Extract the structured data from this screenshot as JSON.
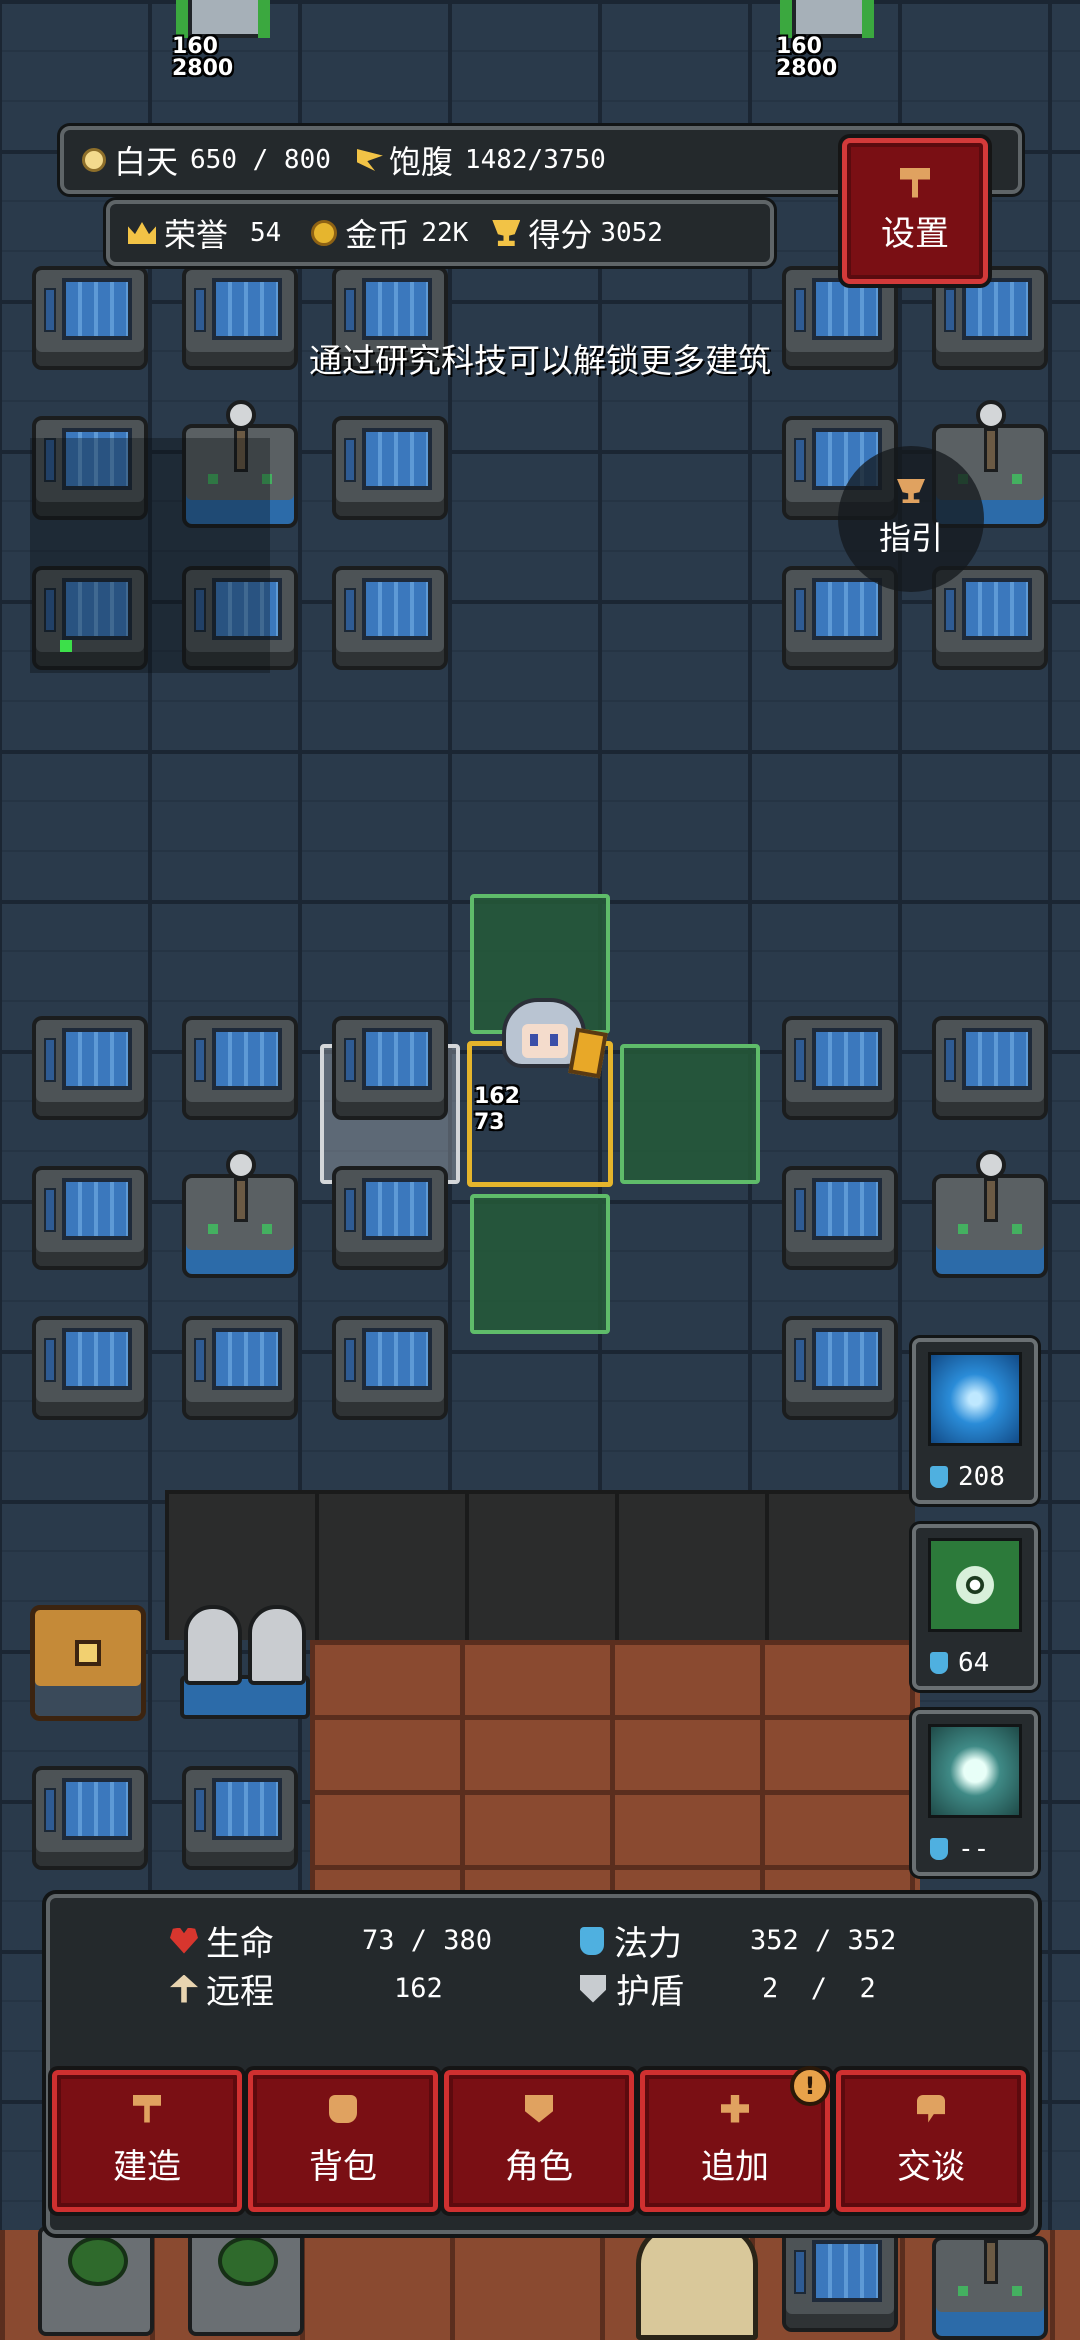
{
  "hud": {
    "day_label": "白天",
    "day_value": "650 / 800",
    "food_label": "饱腹",
    "food_value": "1482/3750",
    "honor_label": "荣誉",
    "honor_value": "54",
    "gold_label": "金币",
    "gold_value": "22K",
    "score_label": "得分",
    "score_value": "3052"
  },
  "settings_label": "设置",
  "guide_label": "指引",
  "hint": "通过研究科技可以解锁更多建筑",
  "enemies": [
    {
      "attack": "160",
      "health": "2800"
    },
    {
      "attack": "160",
      "health": "2800"
    }
  ],
  "hero": {
    "attack": "162",
    "health": "73"
  },
  "skills": [
    {
      "icon": "lightning-skill-icon",
      "cost": "208",
      "color": "#2a8cd8"
    },
    {
      "icon": "eye-skill-icon",
      "cost": "64",
      "color": "#2c7a3a"
    },
    {
      "icon": "shield-skill-icon",
      "cost": "--",
      "color": "#3f8a86"
    }
  ],
  "stats": {
    "life_label": "生命",
    "life_value": "73 / 380",
    "mana_label": "法力",
    "mana_value": "352 / 352",
    "ranged_label": "远程",
    "ranged_value": "162",
    "shield_label": "护盾",
    "shield_value": "2  /  2"
  },
  "menu": {
    "build": "建造",
    "bag": "背包",
    "character": "角色",
    "add": "追加",
    "talk": "交谈",
    "alert": "!"
  },
  "colors": {
    "button_red": "#7a0f14",
    "move_tile": "#5fbc6a",
    "selected_tile": "#e5b52c"
  }
}
